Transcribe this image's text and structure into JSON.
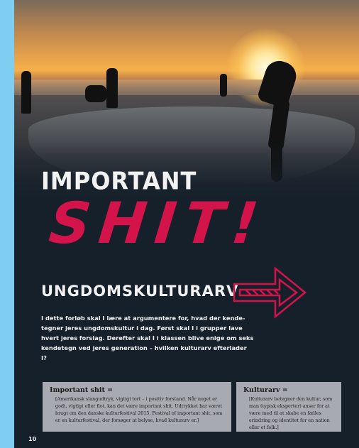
{
  "page": {
    "title_line1": "IMPORTANT",
    "title_big": "SHIT!",
    "subtitle": "UNGDOMSKULTURARV",
    "intro": "I dette forløb skal I lære at argumentere for, hvad der kende-tegner jeres ungdomskultur i dag. Først skal I i grupper lave hvert jeres forslag. Derefter skal I i klassen blive enige om seks kendetegn ved jeres generation – hvilken kulturarv efterlader I?",
    "page_number": "10"
  },
  "boxes": [
    {
      "title": "Important shit =",
      "text": "[Amerikansk slangudtryk, vigtigt lort – i positiv forstand.  Når noget er godt, vigtigt eller  flot, kan det være important shit. Udtrykket har været brugt om den danske kulturfestival 2015, Festival of important shit, som er en kulturfestival, der forsøger at belyse, hvad kulturarv er.]"
    },
    {
      "title": "Kulturarv =",
      "text": "[Kulturarv betegner den kultur, som man (typisk eksperter) anser for at være med til at skabe en fælles erindring og identitet for en nation eller et folk.]"
    }
  ],
  "colors": {
    "background": "#15202b",
    "accent": "#d3144b",
    "box": "#a7aab0",
    "border": "#7fcdf0"
  },
  "icons": [
    "arrow-right-icon"
  ]
}
